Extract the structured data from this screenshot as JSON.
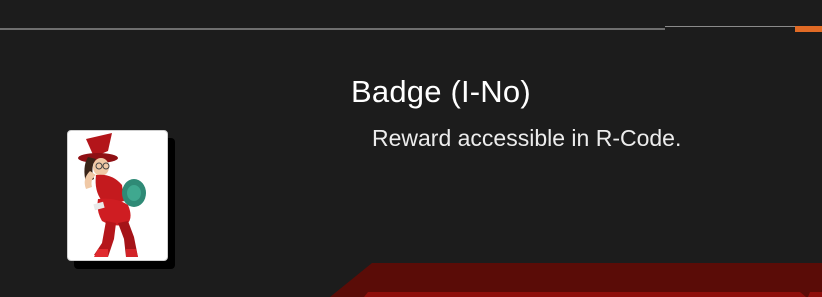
{
  "item": {
    "title": "Badge (I-No)",
    "description": "Reward accessible in R-Code."
  },
  "badge": {
    "icon": "i-no-portrait-icon"
  },
  "colors": {
    "background": "#1c1c1c",
    "accent": "#e06a25",
    "footer_band": "#5a0c07",
    "footer_band_bright": "#8e0f0b"
  }
}
